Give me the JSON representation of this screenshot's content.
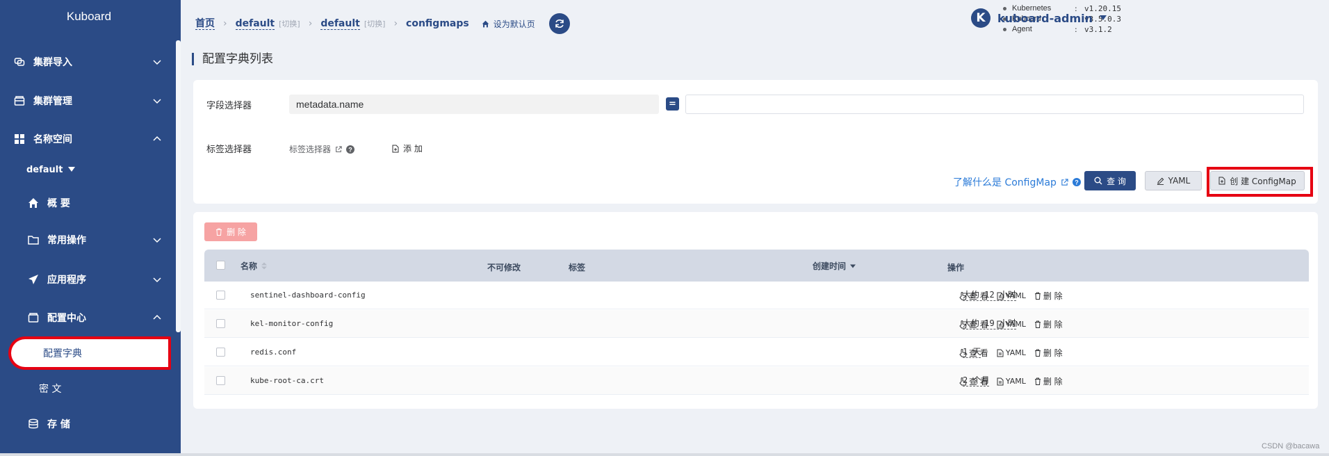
{
  "app": {
    "logo": "Kuboard"
  },
  "sidebar": {
    "items": [
      {
        "label": "集群导入",
        "icon": "cluster-import-icon"
      },
      {
        "label": "集群管理",
        "icon": "cluster-manage-icon"
      },
      {
        "label": "名称空间",
        "icon": "grid-icon"
      },
      {
        "label": "概 要",
        "icon": "home-icon"
      },
      {
        "label": "常用操作",
        "icon": "folder-icon"
      },
      {
        "label": "应用程序",
        "icon": "send-icon"
      },
      {
        "label": "配置中心",
        "icon": "box-icon"
      },
      {
        "label": "存 储",
        "icon": "database-icon"
      }
    ],
    "namespace": "default",
    "active_item": "配置字典",
    "secret_item": "密 文"
  },
  "header": {
    "breadcrumb": {
      "home": "首页",
      "cluster": "default",
      "cluster_switch": "[切换]",
      "namespace": "default",
      "namespace_switch": "[切换]",
      "current": "configmaps",
      "set_default": "设为默认页"
    },
    "versions": [
      {
        "name": "Kubernetes",
        "value": "v1.20.15"
      },
      {
        "name": "Kuboard",
        "value": "v3.5.0.3"
      },
      {
        "name": "Agent",
        "value": "v3.1.2"
      }
    ],
    "user": {
      "avatar_letter": "K",
      "name": "kuboard-admin"
    }
  },
  "page": {
    "title": "配置字典列表"
  },
  "filter": {
    "field_selector_label": "字段选择器",
    "field_selector_value": "metadata.name",
    "operator": "=",
    "label_selector_label": "标签选择器",
    "label_selector_link": "标签选择器",
    "add_label": "添 加",
    "help_link": "了解什么是 ConfigMap",
    "query_button": "查 询",
    "yaml_button": "YAML",
    "create_button": "创 建 ConfigMap"
  },
  "table": {
    "delete_button": "删 除",
    "headers": {
      "name": "名称",
      "immutable": "不可修改",
      "labels": "标签",
      "created": "创建时间",
      "actions": "操作"
    },
    "rows": [
      {
        "name": "sentinel-dashboard-config",
        "created": "大约 12 小时"
      },
      {
        "name": "kel-monitor-config",
        "created": "大约 19 小时"
      },
      {
        "name": "redis.conf",
        "created": "1 天"
      },
      {
        "name": "kube-root-ca.crt",
        "created": "2 个月"
      }
    ],
    "actions": {
      "view": "查 看",
      "yaml": "YAML",
      "delete": "删 除"
    }
  },
  "watermark": "CSDN @bacawa",
  "colors": {
    "primary": "#2b4b86",
    "highlight": "#e60012",
    "link": "#2b7bd8"
  }
}
